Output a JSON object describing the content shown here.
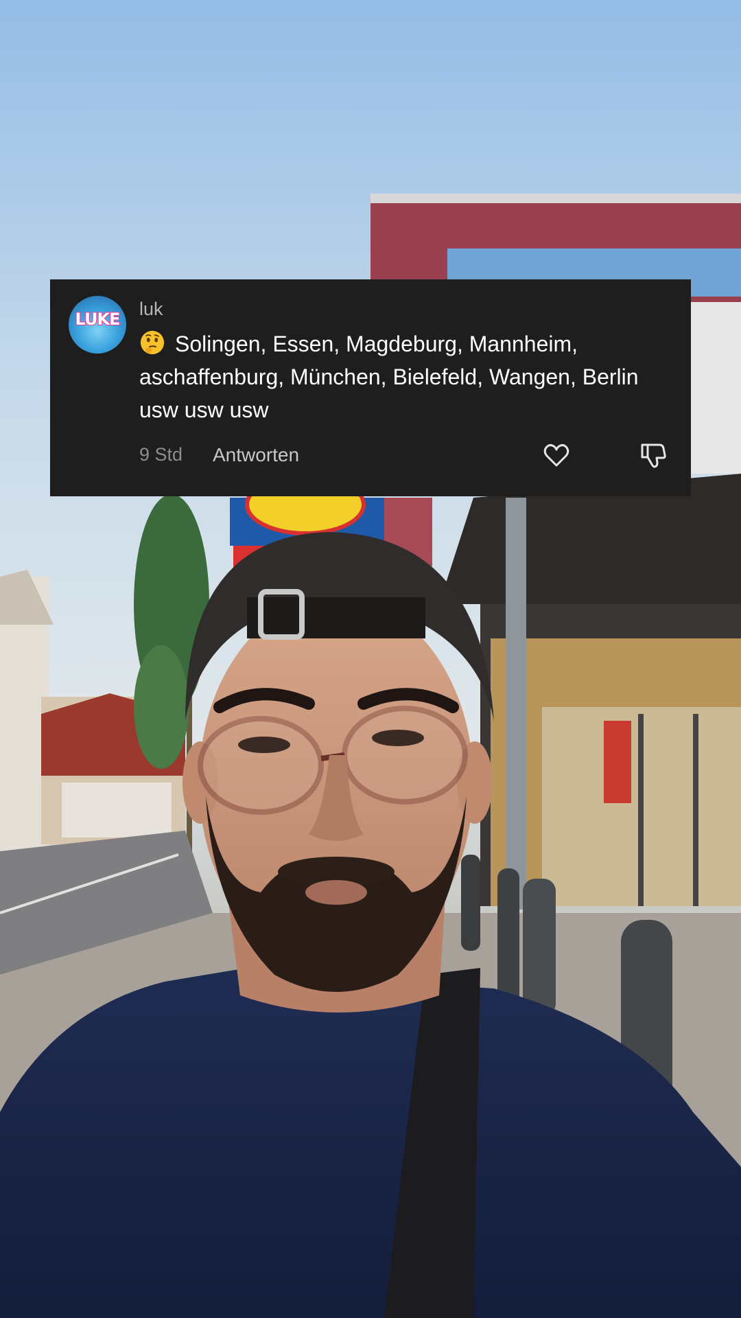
{
  "comment": {
    "username": "luk",
    "avatar_text": "LUKE",
    "emoji": "thinking-face",
    "text": "Solingen, Essen, Magdeburg, Mannheim, aschaffenburg, München, Bielefeld, Wangen, Berlin usw usw usw",
    "time": "9 Std",
    "reply_label": "Antworten",
    "like_icon": "heart-outline",
    "dislike_icon": "thumbs-down-outline"
  },
  "colors": {
    "card_background": "#1e1e1e",
    "text_primary": "#ffffff",
    "text_secondary": "#8d8d8d"
  }
}
